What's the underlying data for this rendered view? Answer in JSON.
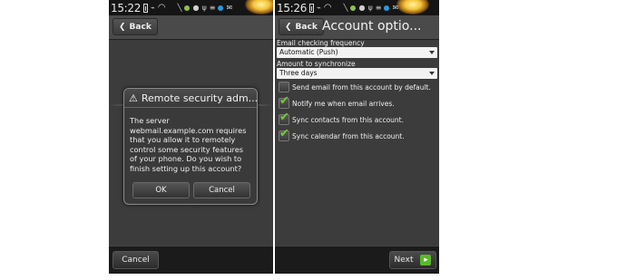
{
  "status_bar": {
    "time_left": "15:22",
    "time_right": "15:26"
  },
  "left_screen": {
    "back_label": "Back",
    "dialog": {
      "title": "Remote security adm...",
      "body_lines": [
        "The server",
        "webmail.example.com requires",
        "that you allow it to remotely",
        "control some security features",
        "of your phone. Do you wish to",
        "finish setting up this account?"
      ],
      "ok_label": "OK",
      "cancel_label": "Cancel"
    },
    "bottom_cancel_label": "Cancel"
  },
  "right_screen": {
    "back_label": "Back",
    "title": "Account optio...",
    "email_checking_label": "Email checking frequency",
    "email_checking_value": "Automatic (Push)",
    "amount_label": "Amount to synchronize",
    "amount_value": "Three days",
    "options": [
      {
        "label": "Send email from this account by default.",
        "checked": false
      },
      {
        "label": "Notify me when email arrives.",
        "checked": true
      },
      {
        "label": "Sync contacts from this account.",
        "checked": true
      },
      {
        "label": "Sync calendar from this account.",
        "checked": true
      }
    ],
    "next_label": "Next"
  },
  "colors": {
    "accent_check": "#6fd12a",
    "next_plus": "#5ab82a",
    "screen_bg": "#3c3c3c"
  },
  "icons": [
    "back-chevron-icon",
    "warning-icon",
    "battery-icon",
    "wifi-icon",
    "check-icon",
    "plus-icon"
  ]
}
